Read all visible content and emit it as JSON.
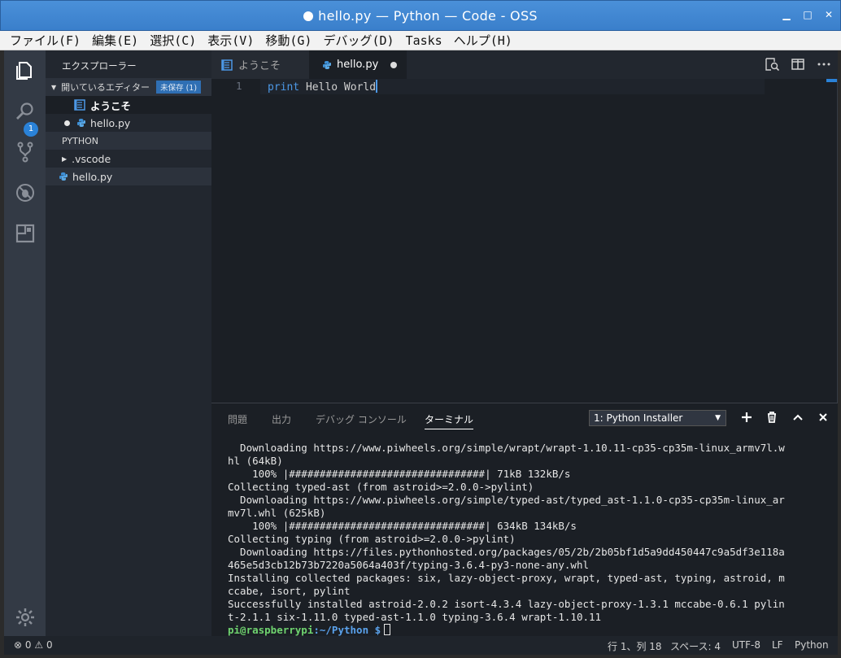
{
  "window": {
    "title": "hello.py — Python — Code - OSS",
    "minimize": "▁",
    "maximize": "□",
    "close": "✕"
  },
  "menu": [
    "ファイル(F)",
    "編集(E)",
    "選択(C)",
    "表示(V)",
    "移動(G)",
    "デバッグ(D)",
    "Tasks",
    "ヘルプ(H)"
  ],
  "activity": {
    "badge": "1"
  },
  "sidebar": {
    "title": "エクスプローラー",
    "open_editors": {
      "label": "開いているエディター",
      "badge": "未保存 (1)",
      "items": [
        "ようこそ",
        "hello.py"
      ]
    },
    "folder": {
      "label": "PYTHON",
      "items": [
        ".vscode",
        "hello.py"
      ]
    }
  },
  "tabs": [
    {
      "label": "ようこそ"
    },
    {
      "label": "hello.py"
    }
  ],
  "editor": {
    "line_number": "1",
    "keyword": "print",
    "rest": " Hello World"
  },
  "panel": {
    "tabs": [
      "問題",
      "出力",
      "デバッグ コンソール",
      "ターミナル"
    ],
    "terminal_select": "1: Python Installer",
    "terminal_lines": [
      "  Downloading https://www.piwheels.org/simple/wrapt/wrapt-1.10.11-cp35-cp35m-linux_armv7l.w",
      "hl (64kB)",
      "    100% |################################| 71kB 132kB/s",
      "Collecting typed-ast (from astroid>=2.0.0->pylint)",
      "  Downloading https://www.piwheels.org/simple/typed-ast/typed_ast-1.1.0-cp35-cp35m-linux_ar",
      "mv7l.whl (625kB)",
      "    100% |################################| 634kB 134kB/s",
      "Collecting typing (from astroid>=2.0.0->pylint)",
      "  Downloading https://files.pythonhosted.org/packages/05/2b/2b05bf1d5a9dd450447c9a5df3e118a",
      "465e5d3cb12b73b7220a5064a403f/typing-3.6.4-py3-none-any.whl",
      "Installing collected packages: six, lazy-object-proxy, wrapt, typed-ast, typing, astroid, m",
      "ccabe, isort, pylint",
      "Successfully installed astroid-2.0.2 isort-4.3.4 lazy-object-proxy-1.3.1 mccabe-0.6.1 pylin",
      "t-2.1.1 six-1.11.0 typed-ast-1.1.0 typing-3.6.4 wrapt-1.10.11"
    ],
    "prompt_user": "pi@raspberrypi",
    "prompt_path": ":~/Python $"
  },
  "status": {
    "errors": "0",
    "warnings": "0",
    "position": "行 1、列 18",
    "spaces": "スペース: 4",
    "encoding": "UTF-8",
    "eol": "LF",
    "language": "Python"
  }
}
